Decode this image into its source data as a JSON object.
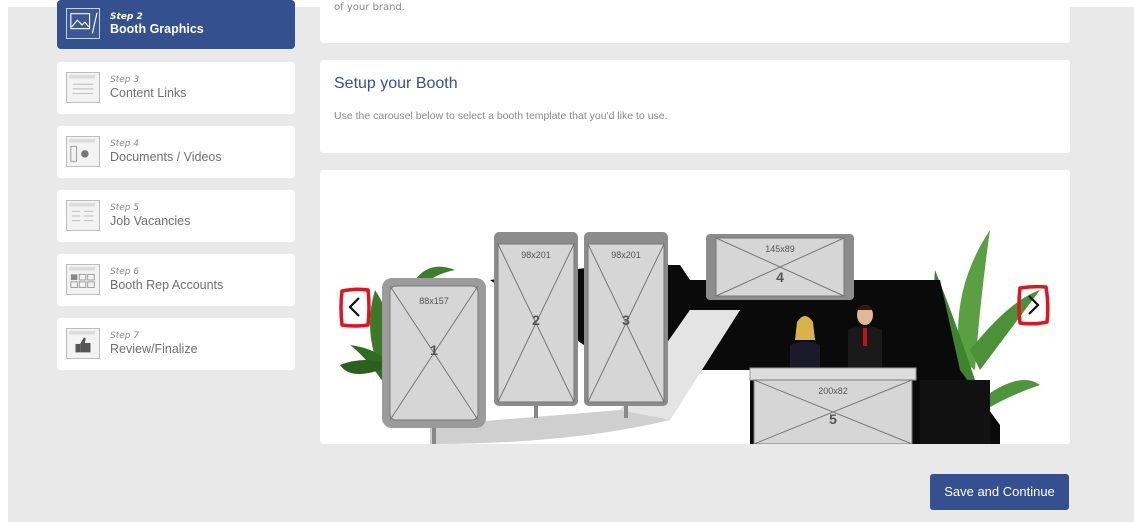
{
  "sidebar": {
    "steps": [
      {
        "num": "Step 2",
        "title": "Booth Graphics",
        "active": true
      },
      {
        "num": "Step 3",
        "title": "Content Links"
      },
      {
        "num": "Step 4",
        "title": "Documents / Videos"
      },
      {
        "num": "Step 5",
        "title": "Job Vacancies"
      },
      {
        "num": "Step 6",
        "title": "Booth Rep Accounts"
      },
      {
        "num": "Step 7",
        "title": "Review/Finalize"
      }
    ]
  },
  "top_card": {
    "text": "of your brand."
  },
  "setup": {
    "title": "Setup your Booth",
    "description": "Use the carousel below to select a booth template that you'd like to use."
  },
  "booth": {
    "panels": [
      {
        "size": "88x157",
        "num": "1"
      },
      {
        "size": "98x201",
        "num": "2"
      },
      {
        "size": "98x201",
        "num": "3"
      },
      {
        "size": "145x89",
        "num": "4"
      },
      {
        "size": "200x82",
        "num": "5"
      }
    ]
  },
  "footer": {
    "save_label": "Save and Continue"
  },
  "colors": {
    "accent": "#34508f",
    "annotation": "#e0141e",
    "background": "#e9e9e9"
  }
}
